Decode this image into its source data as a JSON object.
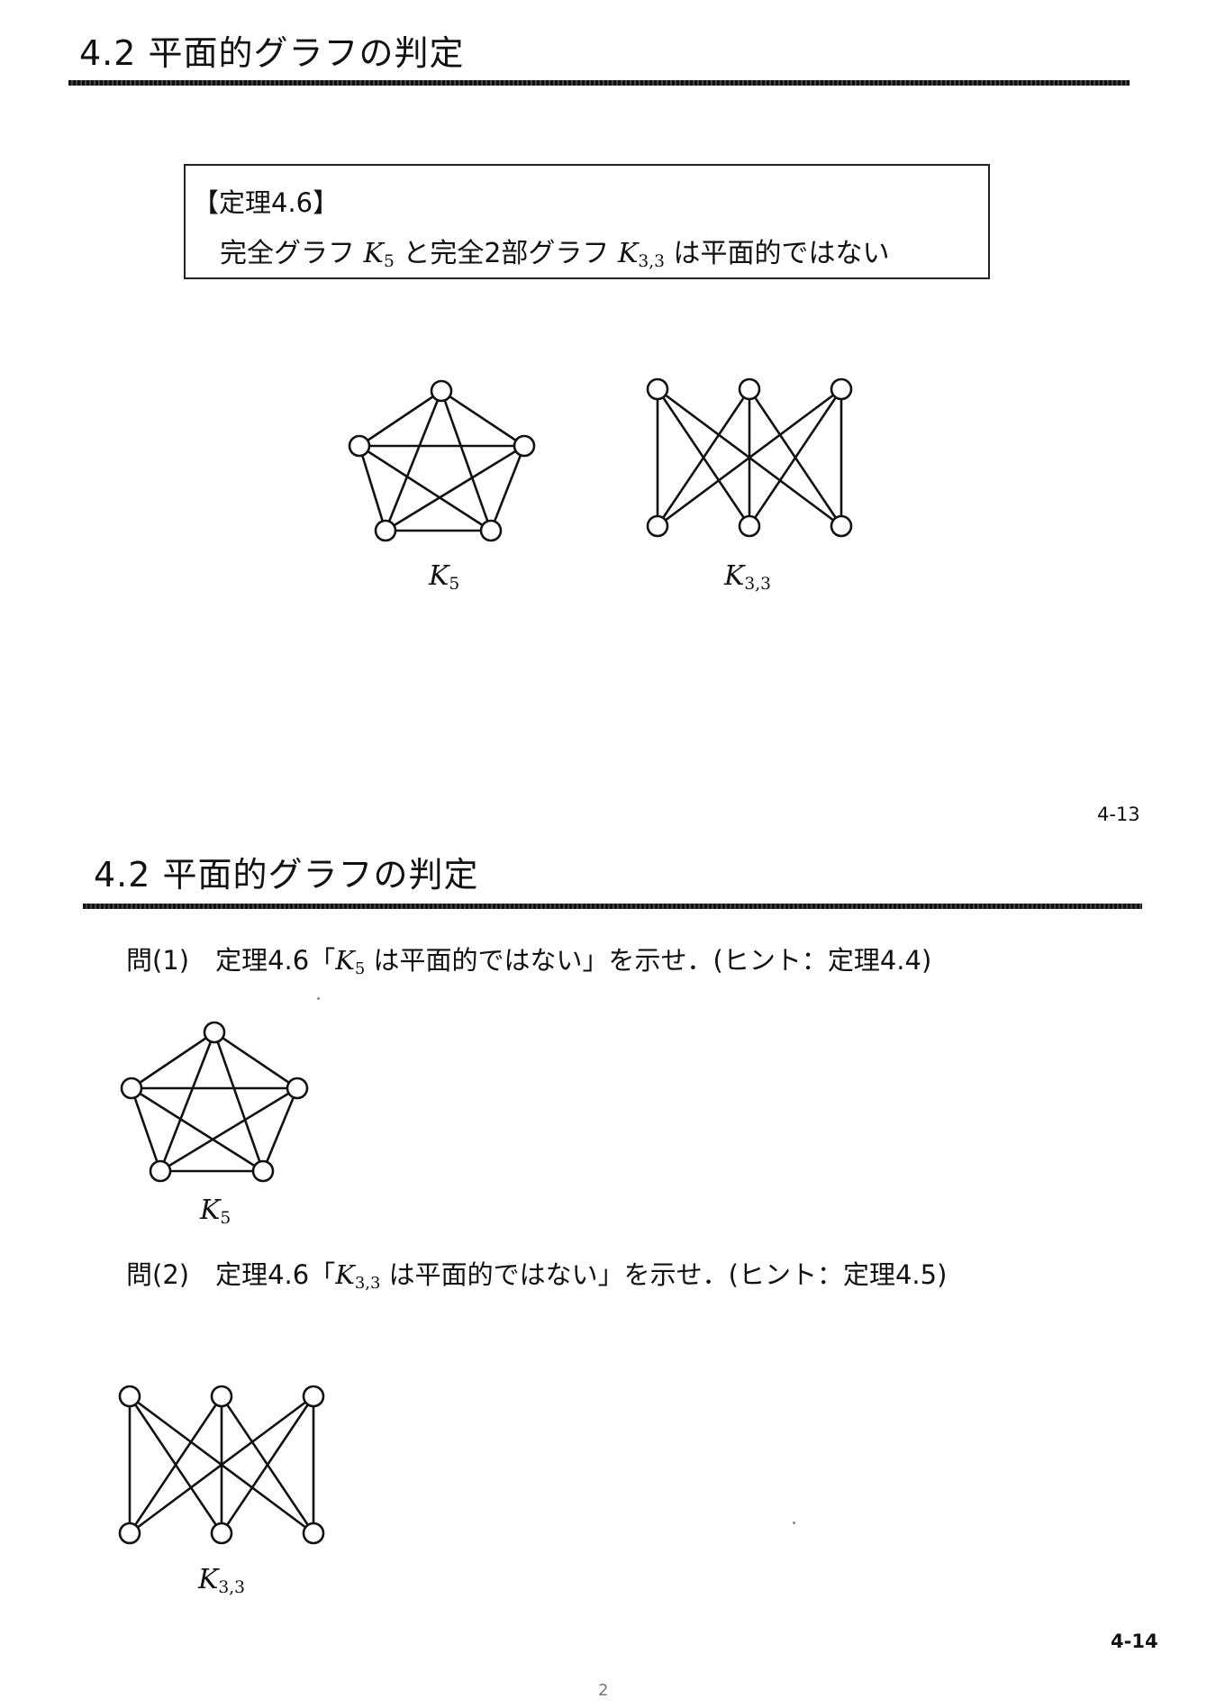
{
  "slide1": {
    "heading": "4.2 平面的グラフの判定",
    "theorem": {
      "title": "【定理4.6】",
      "text_before_k5": "完全グラフ ",
      "k5_base": "K",
      "k5_sub": "5",
      "text_middle": " と完全2部グラフ ",
      "k33_base": "K",
      "k33_sub": "3,3",
      "text_after": " は平面的ではない"
    },
    "graph_k5_label_base": "K",
    "graph_k5_label_sub": "5",
    "graph_k33_label_base": "K",
    "graph_k33_label_sub": "3,3",
    "page_number": "4-13"
  },
  "slide2": {
    "heading": "4.2 平面的グラフの判定",
    "q1": {
      "prefix": "問(1)　定理4.6「",
      "math_base": "K",
      "math_sub": "5",
      "suffix": " は平面的ではない」を示せ．(ヒント：定理4.4)"
    },
    "graph_k5_label_base": "K",
    "graph_k5_label_sub": "5",
    "q2": {
      "prefix": "問(2)　定理4.6「",
      "math_base": "K",
      "math_sub": "3,3",
      "suffix": " は平面的ではない」を示せ．(ヒント：定理4.5)"
    },
    "graph_k33_label_base": "K",
    "graph_k33_label_sub": "3,3",
    "page_number": "4-14"
  },
  "footer_page": "2"
}
